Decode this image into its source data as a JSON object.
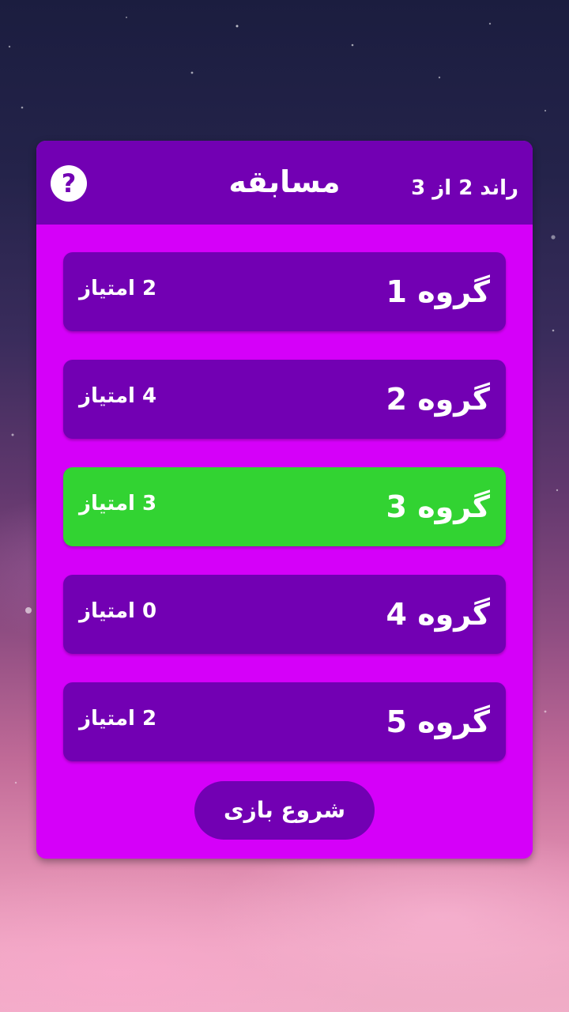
{
  "header": {
    "title": "مسابقه",
    "round_label": "راند 2 از 3",
    "help_icon": "question-mark-icon",
    "help_glyph": "?"
  },
  "groups": [
    {
      "name": "گروه 1",
      "score": "2 امتیاز",
      "selected": false
    },
    {
      "name": "گروه 2",
      "score": "4 امتیاز",
      "selected": false
    },
    {
      "name": "گروه 3",
      "score": "3 امتیاز",
      "selected": true
    },
    {
      "name": "گروه 4",
      "score": "0 امتیاز",
      "selected": false
    },
    {
      "name": "گروه 5",
      "score": "2 امتیاز",
      "selected": false
    }
  ],
  "start_button": {
    "label": "شروع بازی"
  },
  "colors": {
    "panel": "#d500f9",
    "header": "#7200b3",
    "group": "#7200b3",
    "group_selected": "#32d332",
    "text": "#ffffff"
  }
}
